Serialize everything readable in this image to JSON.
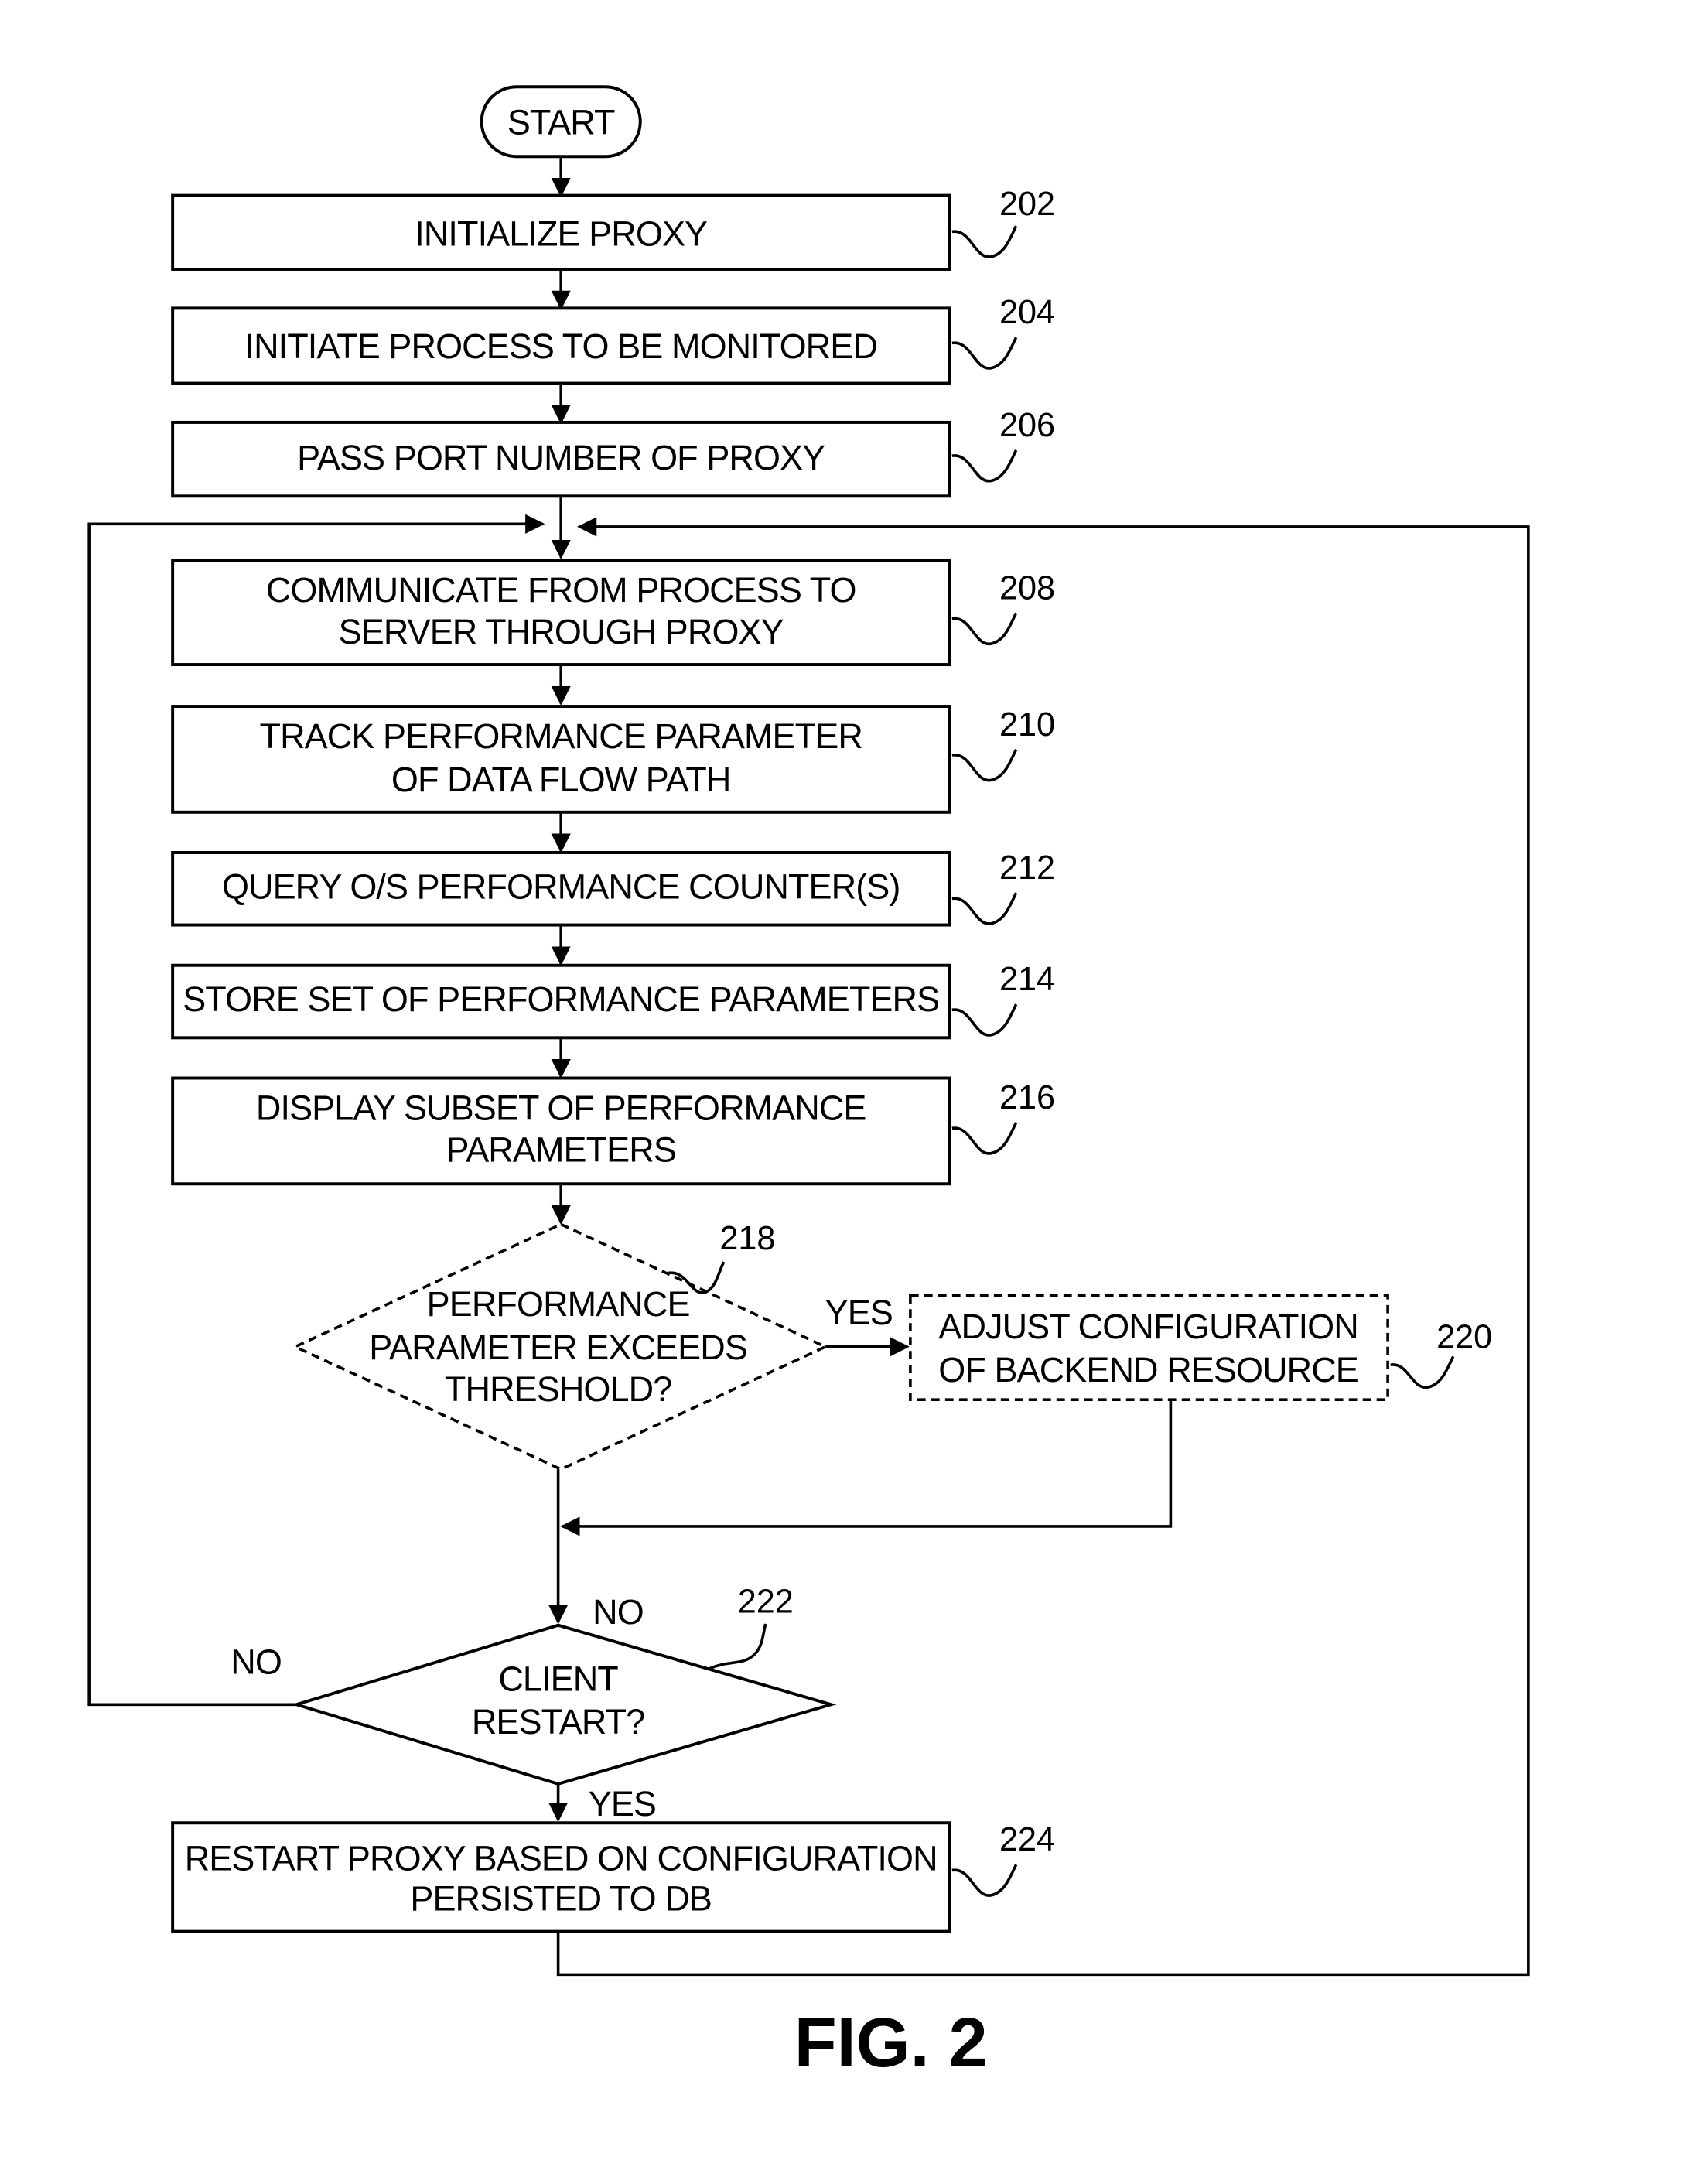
{
  "figure": {
    "caption": "FIG. 2",
    "start_label": "START",
    "steps": [
      {
        "ref": "202",
        "lines": [
          "INITIALIZE PROXY"
        ]
      },
      {
        "ref": "204",
        "lines": [
          "INITIATE PROCESS TO BE MONITORED"
        ]
      },
      {
        "ref": "206",
        "lines": [
          "PASS PORT NUMBER OF PROXY"
        ]
      },
      {
        "ref": "208",
        "lines": [
          "COMMUNICATE FROM PROCESS TO",
          "SERVER THROUGH PROXY"
        ]
      },
      {
        "ref": "210",
        "lines": [
          "TRACK PERFORMANCE PARAMETER",
          "OF DATA FLOW PATH"
        ]
      },
      {
        "ref": "212",
        "lines": [
          "QUERY O/S PERFORMANCE COUNTER(S)"
        ]
      },
      {
        "ref": "214",
        "lines": [
          "STORE SET OF PERFORMANCE PARAMETERS"
        ]
      },
      {
        "ref": "216",
        "lines": [
          "DISPLAY SUBSET OF PERFORMANCE",
          "PARAMETERS"
        ]
      },
      {
        "ref": "224",
        "lines": [
          "RESTART PROXY BASED ON CONFIGURATION",
          "PERSISTED TO DB"
        ]
      }
    ],
    "decision_218": {
      "ref": "218",
      "lines": [
        "PERFORMANCE",
        "PARAMETER EXCEEDS",
        "THRESHOLD?"
      ],
      "yes_label": "YES"
    },
    "step_220": {
      "ref": "220",
      "lines": [
        "ADJUST CONFIGURATION",
        "OF BACKEND RESOURCE"
      ]
    },
    "decision_222": {
      "ref": "222",
      "lines": [
        "CLIENT",
        "RESTART?"
      ],
      "no_top_label": "NO",
      "no_left_label": "NO",
      "yes_label": "YES"
    }
  }
}
